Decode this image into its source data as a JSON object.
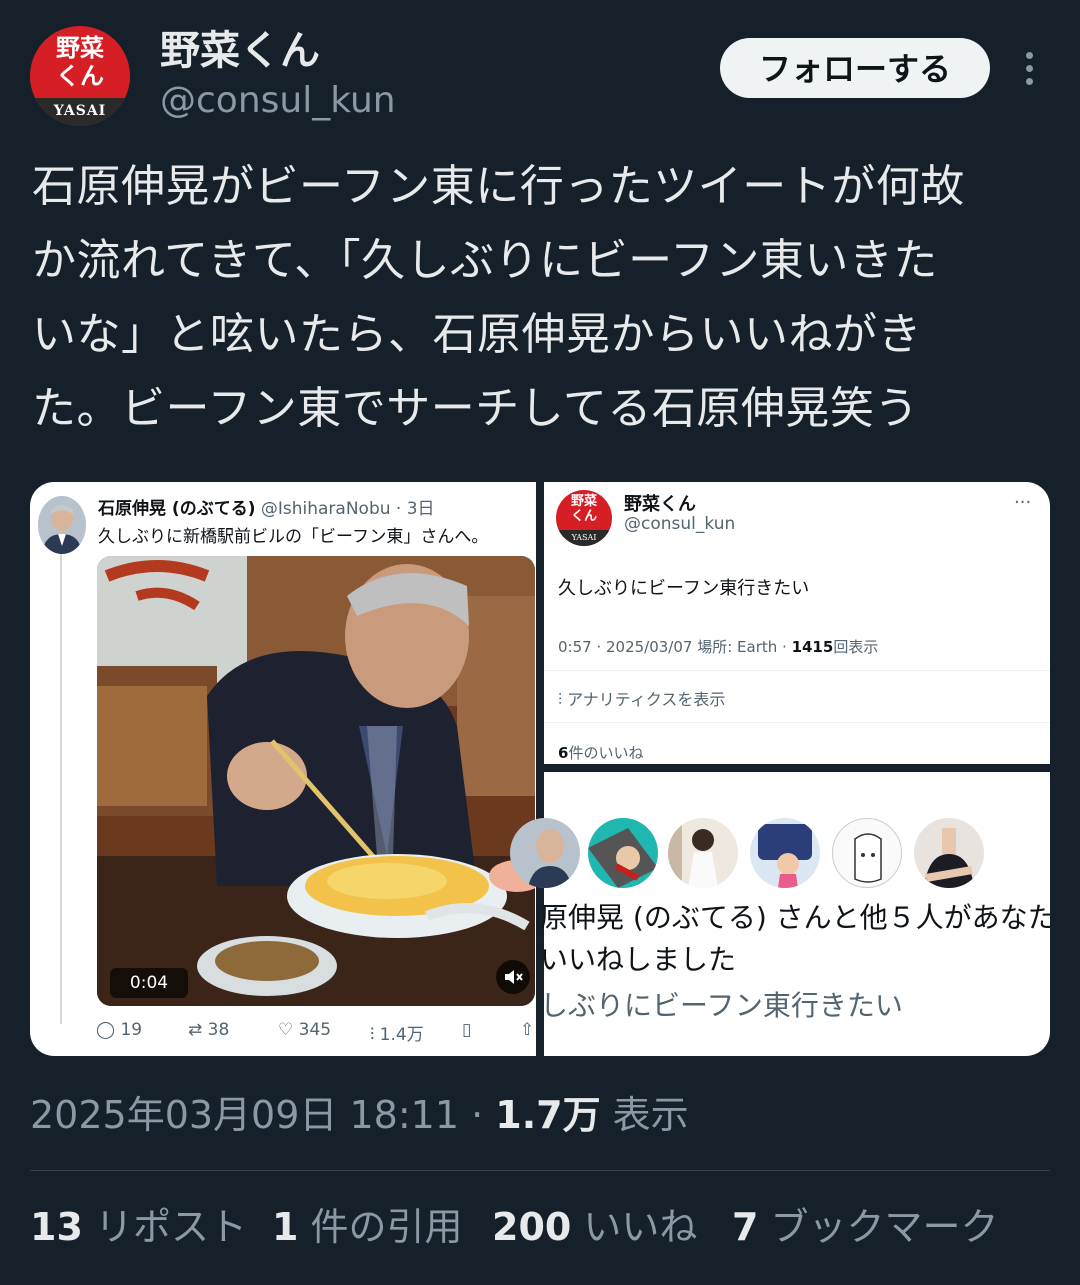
{
  "header": {
    "avatar_line1": "野菜",
    "avatar_line2": "くん",
    "avatar_band": "YASAI",
    "display_name": "野菜くん",
    "handle": "@consul_kun",
    "follow_label": "フォローする"
  },
  "tweet": {
    "line1": "石原伸晃がビーフン東に行ったツイートが何故",
    "line2": "か流れてきて、「久しぶりにビーフン東いきた",
    "line3": "いな」と呟いたら、石原伸晃からいいねがき",
    "line4": "た。ビーフン東でサーチしてる石原伸晃笑う"
  },
  "media_left": {
    "author": "石原伸晃 (のぶてる)",
    "handle_time": "@IshiharaNobu · 3日",
    "text": "久しぶりに新橋駅前ビルの「ビーフン東」さんへ。",
    "video_time": "0:04",
    "replies": "19",
    "reposts": "38",
    "likes": "345",
    "views": "1.4万"
  },
  "media_right_top": {
    "avatar_line1": "野菜",
    "avatar_line2": "くん",
    "avatar_band": "YASAI",
    "name": "野菜くん",
    "handle": "@consul_kun",
    "text": "久しぶりにビーフン東行きたい",
    "meta_prefix": "0:57 · 2025/03/07 場所: Earth · ",
    "meta_views": "1415",
    "meta_suffix": "回表示",
    "analytics": "アナリティクスを表示",
    "likes_count": "6",
    "likes_label": "件のいいね"
  },
  "media_right_bottom": {
    "line1": "原伸晃 (のぶてる) さんと他５人があなた",
    "line2": "いいねしました",
    "line3": "しぶりにビーフン東行きたい"
  },
  "timestamp": {
    "date": "2025年03月09日 18:11 · ",
    "views": "1.7万",
    "views_label": " 表示"
  },
  "stats": {
    "reposts_num": "13",
    "reposts_label": "リポスト",
    "quotes_num": "1",
    "quotes_label": "件の引用",
    "likes_num": "200",
    "likes_label": "いいね",
    "bookmarks_num": "7",
    "bookmarks_label": "ブックマーク"
  },
  "colors": {
    "background": "#15202b",
    "brand_red": "#d61f25",
    "text_primary": "#e7e9ea",
    "text_secondary": "#8b98a5"
  }
}
